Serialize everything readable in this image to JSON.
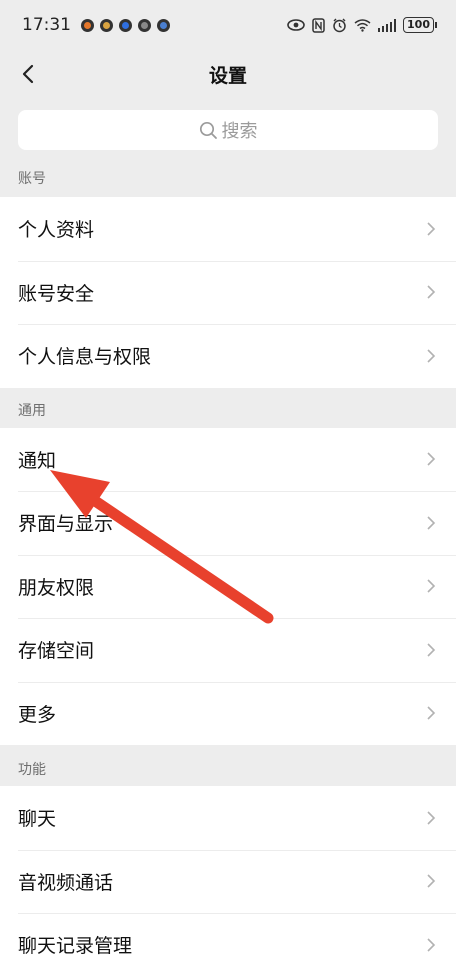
{
  "status_bar": {
    "time": "17:31",
    "battery": "100"
  },
  "nav": {
    "title": "设置"
  },
  "search": {
    "placeholder": "搜索"
  },
  "sections": [
    {
      "label": "账号",
      "items": [
        "个人资料",
        "账号安全",
        "个人信息与权限"
      ]
    },
    {
      "label": "通用",
      "items": [
        "通知",
        "界面与显示",
        "朋友权限",
        "存储空间",
        "更多"
      ]
    },
    {
      "label": "功能",
      "items": [
        "聊天",
        "音视频通话",
        "聊天记录管理"
      ]
    }
  ],
  "annotation": {
    "color": "#e8412d",
    "target": "通知"
  }
}
